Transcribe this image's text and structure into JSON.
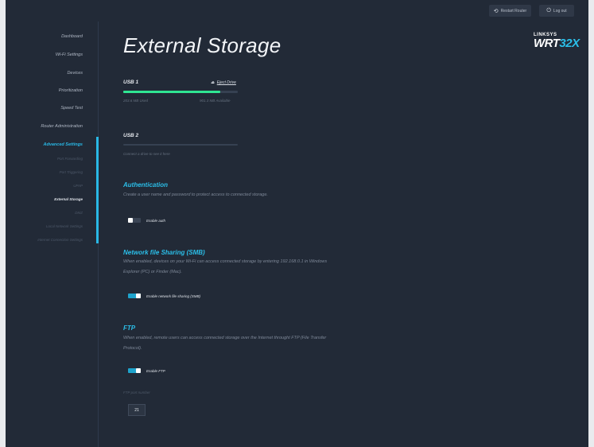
{
  "topbar": {
    "restart_label": "Restart Router",
    "logout_label": "Log out"
  },
  "logo": {
    "brand": "LINKSYS",
    "model_prefix": "WRT",
    "model_suffix": "32X"
  },
  "nav": {
    "items": [
      "Dashboard",
      "Wi-Fi Settings",
      "Devices",
      "Prioritization",
      "Speed Test",
      "Router Administration",
      "Advanced Settings",
      "Port Forwarding",
      "Port Triggering",
      "UPnP",
      "External Storage",
      "DMZ",
      "Local Network Settings",
      "Internet Connection Settings"
    ]
  },
  "page": {
    "title": "External Storage"
  },
  "usb1": {
    "label": "USB 1",
    "eject_icon": "eject-icon",
    "eject_label": "Eject Drive",
    "used": "203.6 MB Used",
    "available": "901.3 MB Available",
    "used_fraction": 0.85
  },
  "usb2": {
    "label": "USB 2",
    "message": "Connect a drive to see it here"
  },
  "auth": {
    "title": "Authentication",
    "desc": "Create a user name and password to protect access to connected storage.",
    "toggle_label": "Enable auth",
    "enabled": false
  },
  "smb": {
    "title": "Network file Sharing (SMB)",
    "desc": "When enabled, devices on your Wi-Fi can access connected storage by entering 192.168.0.1 in Windows Explorer (PC) or Finder (Mac).",
    "toggle_label": "Enable network file sharing (SMB)",
    "enabled": true
  },
  "ftp": {
    "title": "FTP",
    "desc": "When enabled, remote users can access connected storage over the Internet throught FTP (File Transfer Protocol).",
    "toggle_label": "Enable FTP",
    "enabled": true,
    "port_label": "FTP port number",
    "port_value": "21"
  },
  "colors": {
    "accent": "#2bbfe9",
    "usage_bar": "#2fe592",
    "background": "#222a37"
  }
}
